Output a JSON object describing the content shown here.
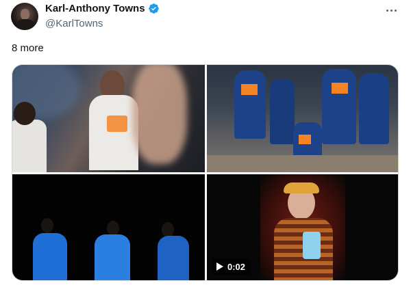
{
  "author": {
    "display_name": "Karl-Anthony Towns",
    "handle": "@KarlTowns",
    "verified_color": "#1d9bf0"
  },
  "menu": {
    "icon": "more-dots-icon"
  },
  "tweet": {
    "text": "8 more"
  },
  "media": {
    "video_duration": "0:02",
    "tiles": [
      {
        "kind": "photo",
        "description_icon": "image"
      },
      {
        "kind": "photo",
        "description_icon": "image"
      },
      {
        "kind": "photo",
        "description_icon": "image"
      },
      {
        "kind": "video",
        "description_icon": "play-icon"
      }
    ]
  },
  "colors": {
    "text_primary": "#0f1419",
    "text_secondary": "#536471",
    "border": "#cfd9de",
    "knicks_blue": "#1d428a",
    "knicks_orange": "#f58426"
  }
}
